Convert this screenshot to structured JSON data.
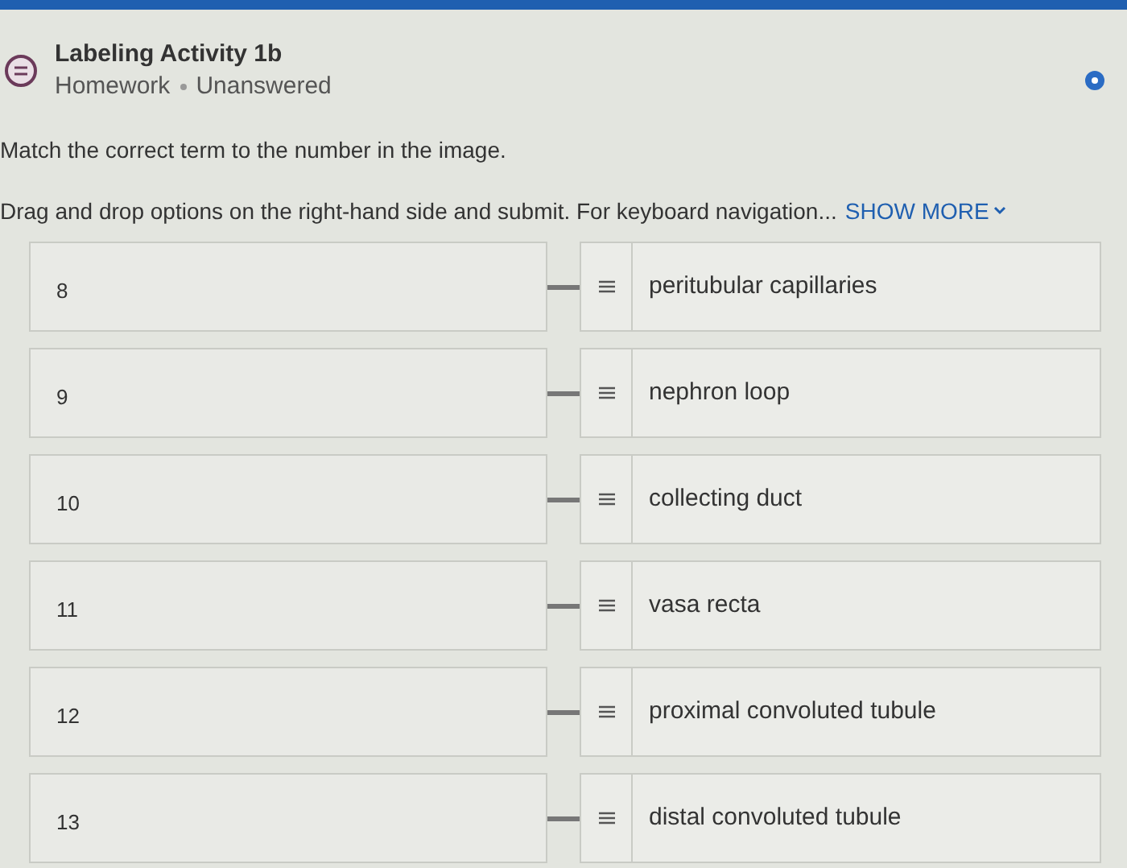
{
  "header": {
    "title": "Labeling Activity 1b",
    "type": "Homework",
    "status": "Unanswered"
  },
  "instructions": [
    "Match the correct term to the number in the image.",
    "Drag and drop options on the right-hand side and submit. For keyboard navigation..."
  ],
  "show_more": "SHOW MORE",
  "pairs": [
    {
      "target": "8",
      "option": "peritubular capillaries"
    },
    {
      "target": "9",
      "option": "nephron loop"
    },
    {
      "target": "10",
      "option": "collecting duct"
    },
    {
      "target": "11",
      "option": "vasa recta"
    },
    {
      "target": "12",
      "option": "proximal convoluted tubule"
    },
    {
      "target": "13",
      "option": "distal convoluted tubule"
    }
  ]
}
